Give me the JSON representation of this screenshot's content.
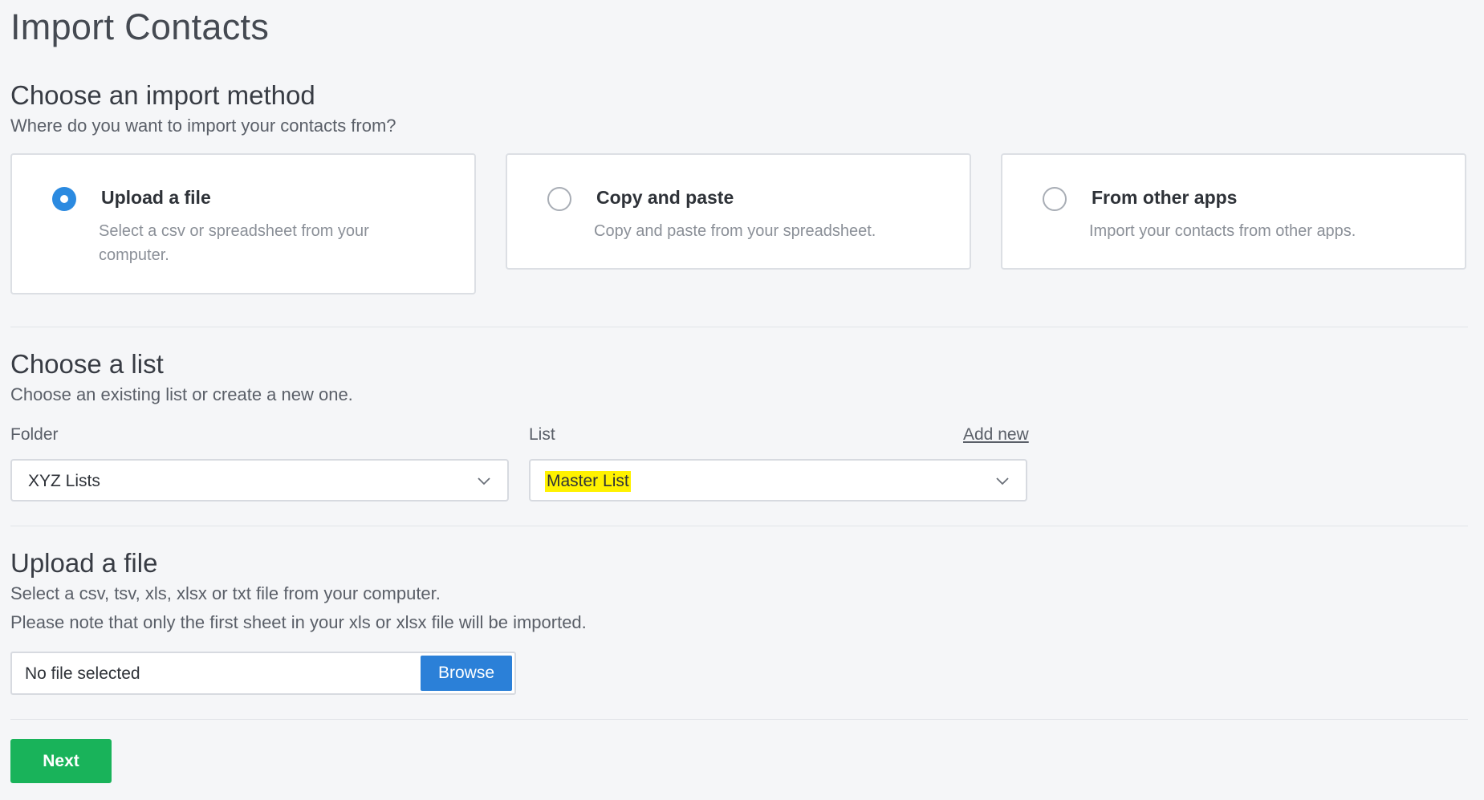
{
  "page_title": "Import Contacts",
  "import_method": {
    "title": "Choose an import method",
    "subtitle": "Where do you want to import your contacts from?",
    "options": [
      {
        "label": "Upload a file",
        "description": "Select a csv or spreadsheet from your computer.",
        "selected": true
      },
      {
        "label": "Copy and paste",
        "description": "Copy and paste from your spreadsheet.",
        "selected": false
      },
      {
        "label": "From other apps",
        "description": "Import your contacts from other apps.",
        "selected": false
      }
    ]
  },
  "list_section": {
    "title": "Choose a list",
    "subtitle": "Choose an existing list or create a new one.",
    "folder_label": "Folder",
    "folder_value": "XYZ Lists",
    "list_label": "List",
    "add_new_label": "Add new",
    "list_value": "Master List"
  },
  "upload_section": {
    "title": "Upload a file",
    "line1": "Select a csv, tsv, xls, xlsx or txt file from your computer.",
    "line2": "Please note that only the first sheet in your xls or xlsx file will be imported.",
    "file_status": "No file selected",
    "browse_label": "Browse"
  },
  "next_label": "Next",
  "colors": {
    "background": "#f5f6f8",
    "radio_selected": "#2b8ae0",
    "browse_button": "#2b80d8",
    "next_button": "#19b35a",
    "highlight": "#fff200"
  }
}
